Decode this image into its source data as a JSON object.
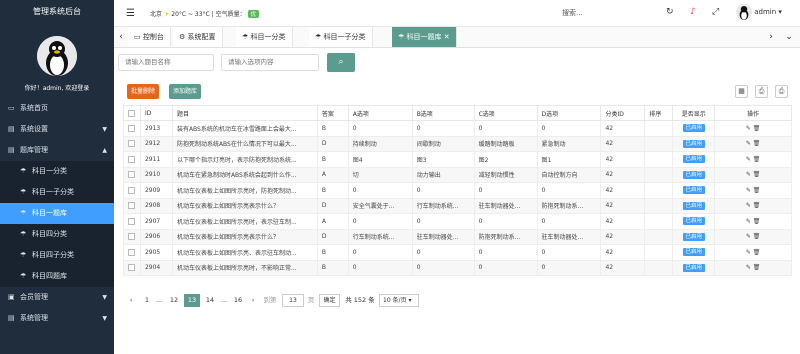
{
  "sidebar": {
    "title": "管理系统后台",
    "welcome": "你好！admin, 欢迎登录",
    "items": [
      {
        "label": "系统首页",
        "icon": "monitor-icon",
        "glyph": "▭",
        "caret": ""
      },
      {
        "label": "系统设置",
        "icon": "settings-icon",
        "glyph": "▤",
        "caret": "▼"
      },
      {
        "label": "题库管理",
        "icon": "list-icon",
        "glyph": "▤",
        "caret": "▲"
      },
      {
        "label": "科目一分类",
        "icon": "umbrella-icon",
        "glyph": "☂",
        "caret": "",
        "sub": true
      },
      {
        "label": "科目一子分类",
        "icon": "umbrella-icon",
        "glyph": "☂",
        "caret": "",
        "sub": true
      },
      {
        "label": "科目一题库",
        "icon": "umbrella-icon",
        "glyph": "☂",
        "caret": "",
        "sub": true,
        "active": true
      },
      {
        "label": "科目四分类",
        "icon": "umbrella-icon",
        "glyph": "☂",
        "caret": "",
        "sub": true
      },
      {
        "label": "科目四子分类",
        "icon": "umbrella-icon",
        "glyph": "☂",
        "caret": "",
        "sub": true
      },
      {
        "label": "科目四题库",
        "icon": "umbrella-icon",
        "glyph": "☂",
        "caret": "",
        "sub": true
      },
      {
        "label": "会员管理",
        "icon": "folder-icon",
        "glyph": "▣",
        "caret": "▼"
      },
      {
        "label": "系统管理",
        "icon": "list-icon",
        "glyph": "▤",
        "caret": "▼"
      }
    ]
  },
  "topbar": {
    "city": "北京",
    "temp": "20°C ~ 33°C",
    "air_label": "| 空气质量：",
    "air_value": "优",
    "search": "搜索...",
    "user": "admin"
  },
  "tabs": [
    {
      "label": "控制台",
      "glyph": "▭"
    },
    {
      "label": "系统配置",
      "glyph": "⚙"
    },
    {
      "label": "科目一分类",
      "glyph": "☂"
    },
    {
      "label": "科目一子分类",
      "glyph": "☂"
    },
    {
      "label": "科目一题库",
      "glyph": "☂",
      "active": true,
      "close": "✕"
    }
  ],
  "filters": {
    "name_placeholder": "请输入题目名称",
    "option_placeholder": "请输入选项内容"
  },
  "actions": {
    "batch_delete": "批量删除",
    "add": "添加题库"
  },
  "table": {
    "headers": [
      "",
      "ID",
      "题目",
      "答案",
      "A选项",
      "B选项",
      "C选项",
      "D选项",
      "分类ID",
      "排序",
      "是否显示",
      "操作"
    ],
    "rows": [
      [
        "2913",
        "装有ABS系统的机动车在冰雪路面上会最大...",
        "B",
        "0",
        "0",
        "0",
        "0",
        "42",
        "",
        "已启用"
      ],
      [
        "2912",
        "防抱死制动系统ABS在什么情况下可以最大...",
        "D",
        "持续制动",
        "间歇制动",
        "缓踏制动踏板",
        "紧急制动",
        "42",
        "",
        "已启用"
      ],
      [
        "2911",
        "以下哪个指示灯亮时，表示防抱死制动系统...",
        "B",
        "图4",
        "图3",
        "图2",
        "图1",
        "42",
        "",
        "已启用"
      ],
      [
        "2910",
        "机动车在紧急制动时ABS系统会起到什么作...",
        "A",
        "切",
        "动力输出",
        "减轻制动惯性",
        "自动控制方向",
        "42",
        "",
        "已启用"
      ],
      [
        "2909",
        "机动车仪表板上如图所示亮时，防抱死制动...",
        "B",
        "0",
        "0",
        "0",
        "0",
        "42",
        "",
        "已启用"
      ],
      [
        "2908",
        "机动车仪表板上如图所示亮表示什么？",
        "D",
        "安全气囊处于...",
        "行车制动系统...",
        "驻车制动器处...",
        "防抱死制动系...",
        "42",
        "",
        "已启用"
      ],
      [
        "2907",
        "机动车仪表板上如图所示亮时，表示驻车制...",
        "A",
        "0",
        "0",
        "0",
        "0",
        "42",
        "",
        "已启用"
      ],
      [
        "2906",
        "机动车仪表板上如图所示亮表示什么？",
        "D",
        "行车制动系统...",
        "驻车制动器处...",
        "防抱死制动系...",
        "驻车制动器处...",
        "42",
        "",
        "已启用"
      ],
      [
        "2905",
        "机动车仪表板上如图所示亮、表示驻车制动...",
        "B",
        "0",
        "0",
        "0",
        "0",
        "42",
        "",
        "已启用"
      ],
      [
        "2904",
        "机动车仪表板上如图所示亮时，不影响正常...",
        "B",
        "0",
        "0",
        "0",
        "0",
        "42",
        "",
        "已启用"
      ]
    ]
  },
  "pager": {
    "prev": "‹",
    "p1": "1",
    "dots1": "...",
    "p12": "12",
    "cur": "13",
    "p14": "14",
    "dots2": "...",
    "p16": "16",
    "next": "›",
    "goto": "到第",
    "page_input": "13",
    "page_unit": "页",
    "confirm": "确定",
    "total": "共 152 条",
    "size": "10 条/页"
  }
}
